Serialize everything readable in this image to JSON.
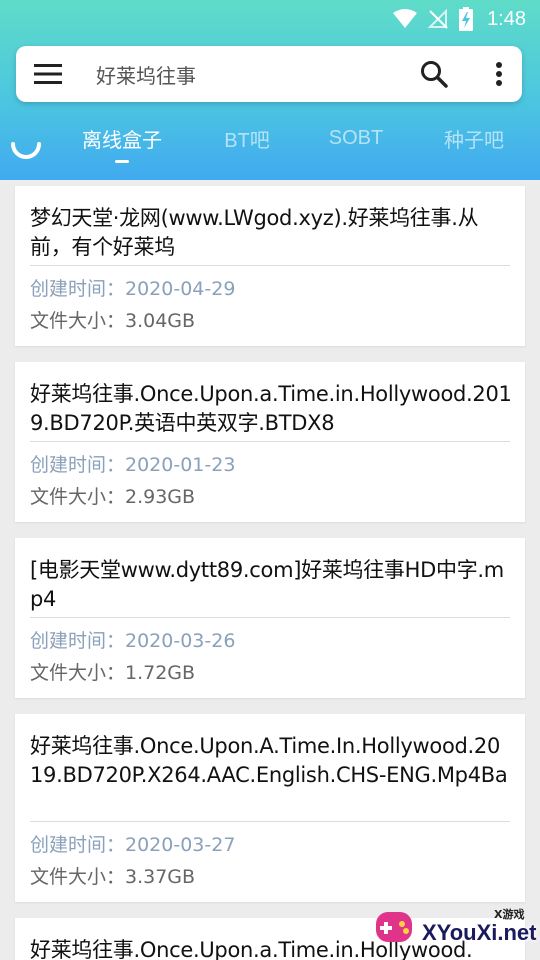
{
  "status_bar": {
    "time": "1:48",
    "icons": [
      "wifi-icon",
      "no-signal-icon",
      "battery-charging-icon"
    ]
  },
  "search": {
    "query": "好莱坞往事",
    "menu_icon": "hamburger-menu-icon",
    "search_icon": "search-icon",
    "more_icon": "more-vertical-icon"
  },
  "tabs": [
    {
      "label": "离线盒子",
      "active": true
    },
    {
      "label": "BT吧",
      "active": false
    },
    {
      "label": "SOBT",
      "active": false
    },
    {
      "label": "种子吧",
      "active": false
    }
  ],
  "results": [
    {
      "title": "梦幻天堂·龙网(www.LWgod.xyz).好莱坞往事.从前，有个好莱坞",
      "date_label": "创建时间：2020-04-29",
      "size_label": "文件大小：3.04GB"
    },
    {
      "title": "好莱坞往事.Once.Upon.a.Time.in.Hollywood.2019.BD720P.英语中英双字.BTDX8",
      "date_label": "创建时间：2020-01-23",
      "size_label": "文件大小：2.93GB"
    },
    {
      "title": "[电影天堂www.dytt89.com]好莱坞往事HD中字.mp4",
      "date_label": "创建时间：2020-03-26",
      "size_label": "文件大小：1.72GB"
    },
    {
      "title": "好莱坞往事.Once.Upon.A.Time.In.Hollywood.2019.BD720P.X264.AAC.English.CHS-ENG.Mp4Ba",
      "date_label": "创建时间：2020-03-27",
      "size_label": "文件大小：3.37GB"
    },
    {
      "title": "好莱坞往事.Once.Upon.a.Time.in.Hollywood.",
      "date_label": "",
      "size_label": ""
    }
  ],
  "watermark": {
    "site": "XYouXi.net",
    "small": "X游戏"
  },
  "colors": {
    "header_top": "#5fdcc8",
    "header_bottom": "#41aaf0",
    "date_text": "#8aa0bb"
  }
}
